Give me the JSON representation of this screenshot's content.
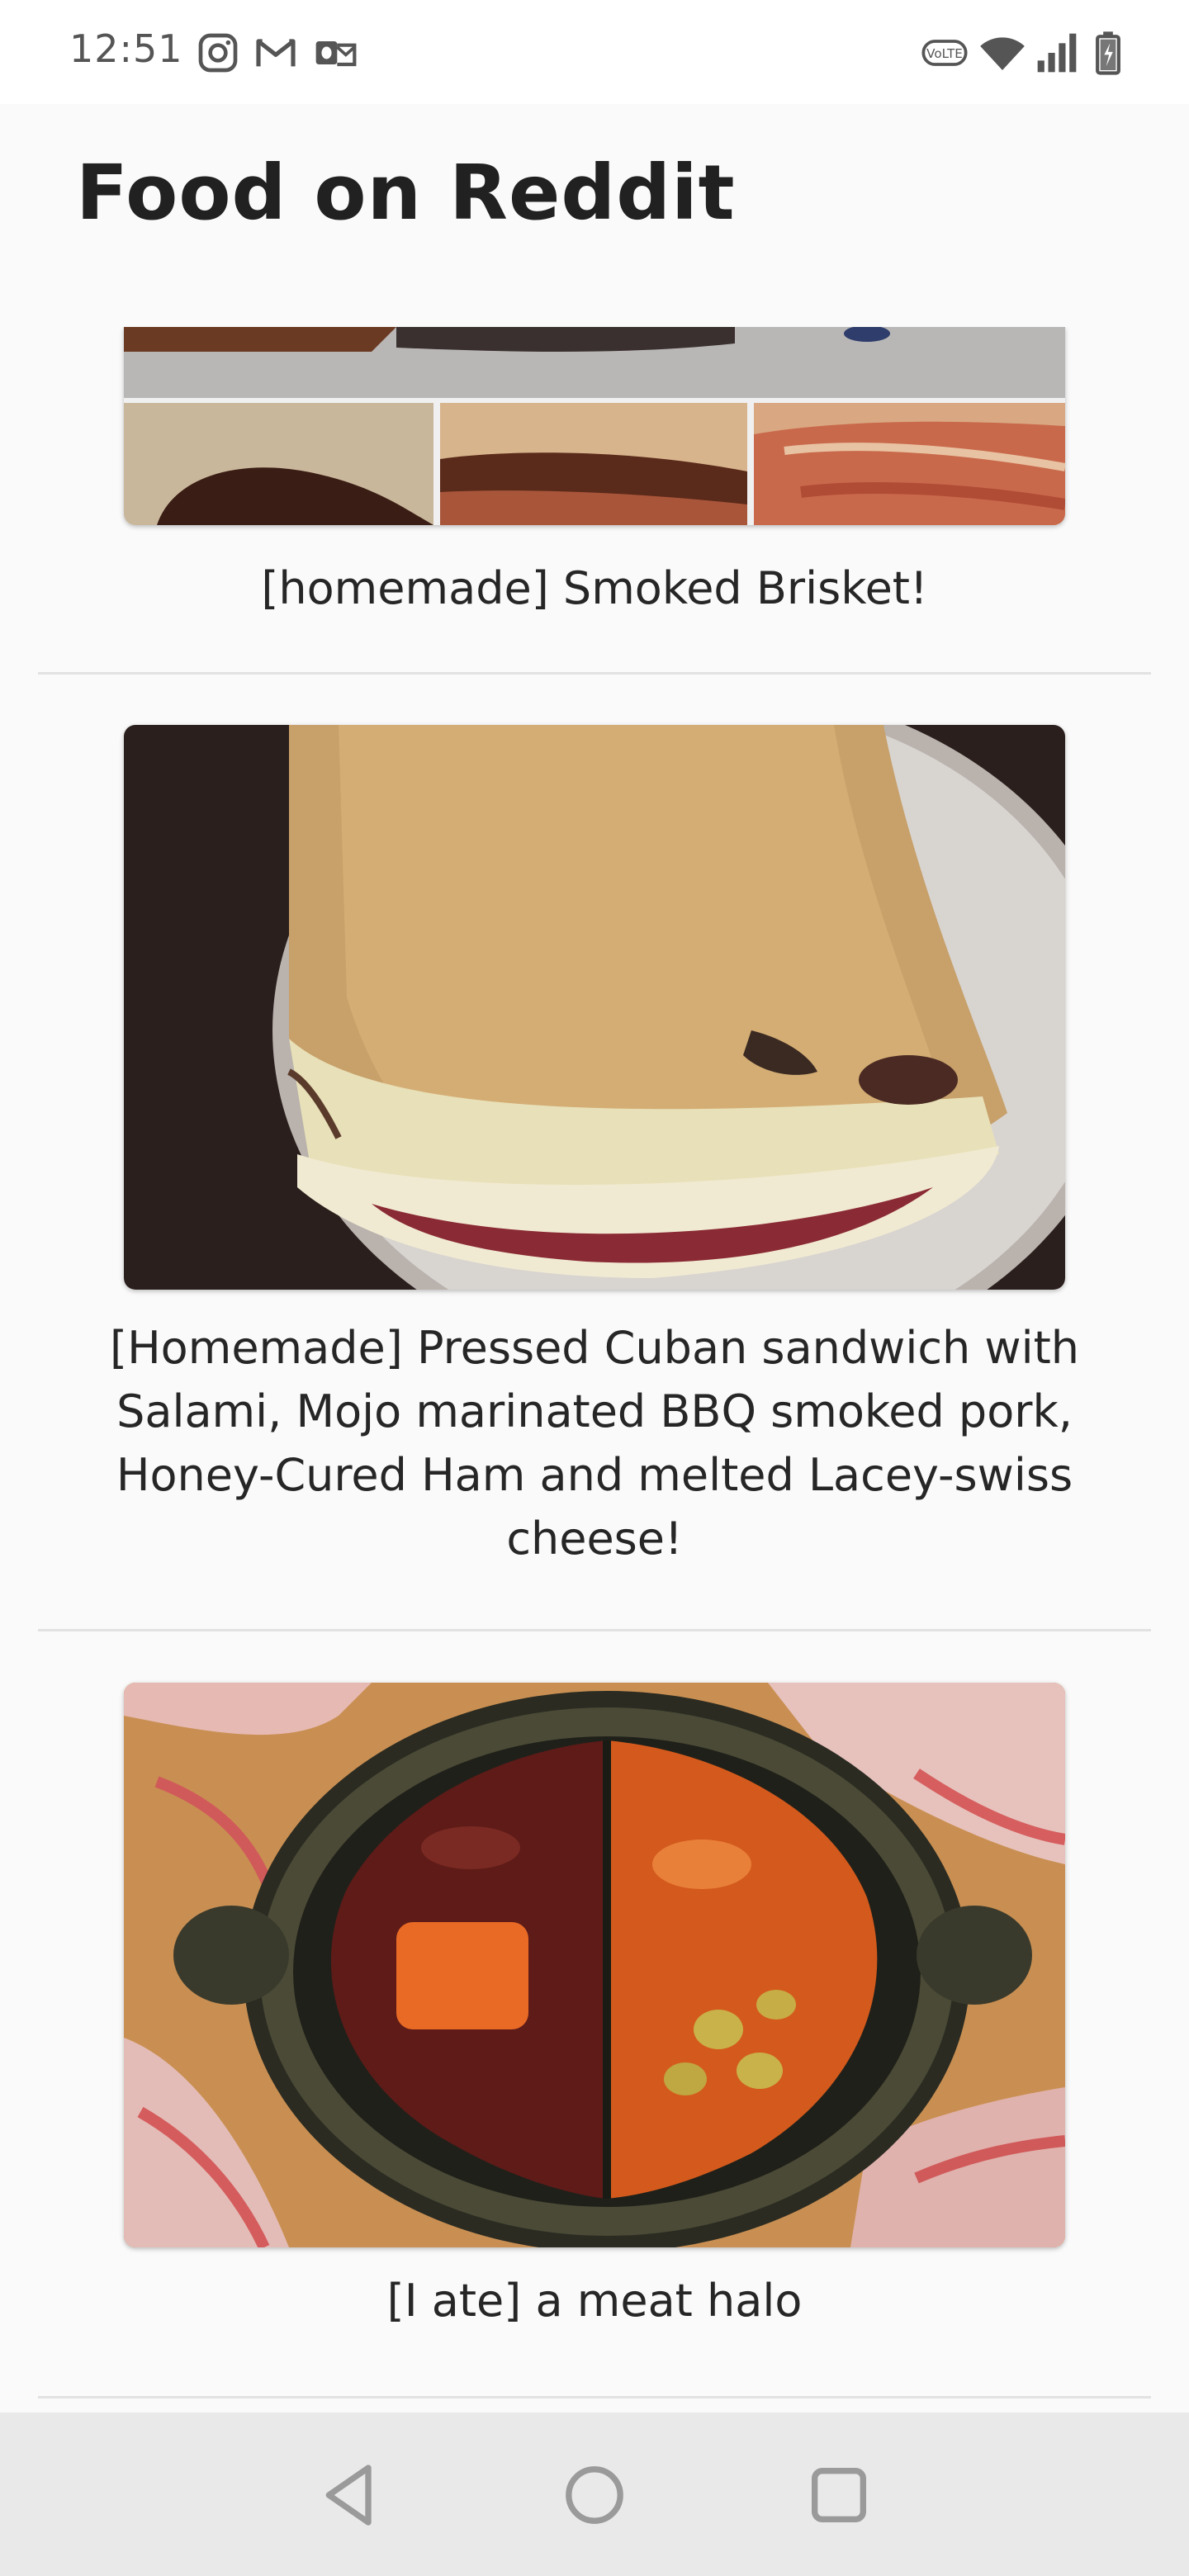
{
  "status_bar": {
    "time": "12:51",
    "left_icons": [
      "instagram-icon",
      "gmail-icon",
      "outlook-icon"
    ],
    "right_icons": [
      "volte-icon",
      "wifi-icon",
      "signal-icon",
      "battery-icon"
    ],
    "volte_label": "VoLTE"
  },
  "header": {
    "title": "Food on Reddit"
  },
  "feed": {
    "posts": [
      {
        "title": "[homemade] Smoked Brisket!"
      },
      {
        "title": "[Homemade] Pressed Cuban sandwich with Salami, Mojo marinated BBQ smoked pork, Honey-Cured Ham and melted Lacey-swiss cheese!"
      },
      {
        "title": "[I ate] a meat halo"
      }
    ]
  },
  "nav_bar": {
    "buttons": [
      "back-icon",
      "home-icon",
      "recents-icon"
    ]
  },
  "colors": {
    "background": "#fafafa",
    "status_bar_bg": "#ffffff",
    "nav_bar_bg": "#e9e9e9",
    "title_text": "#212121",
    "divider": "#e2e2e2"
  }
}
